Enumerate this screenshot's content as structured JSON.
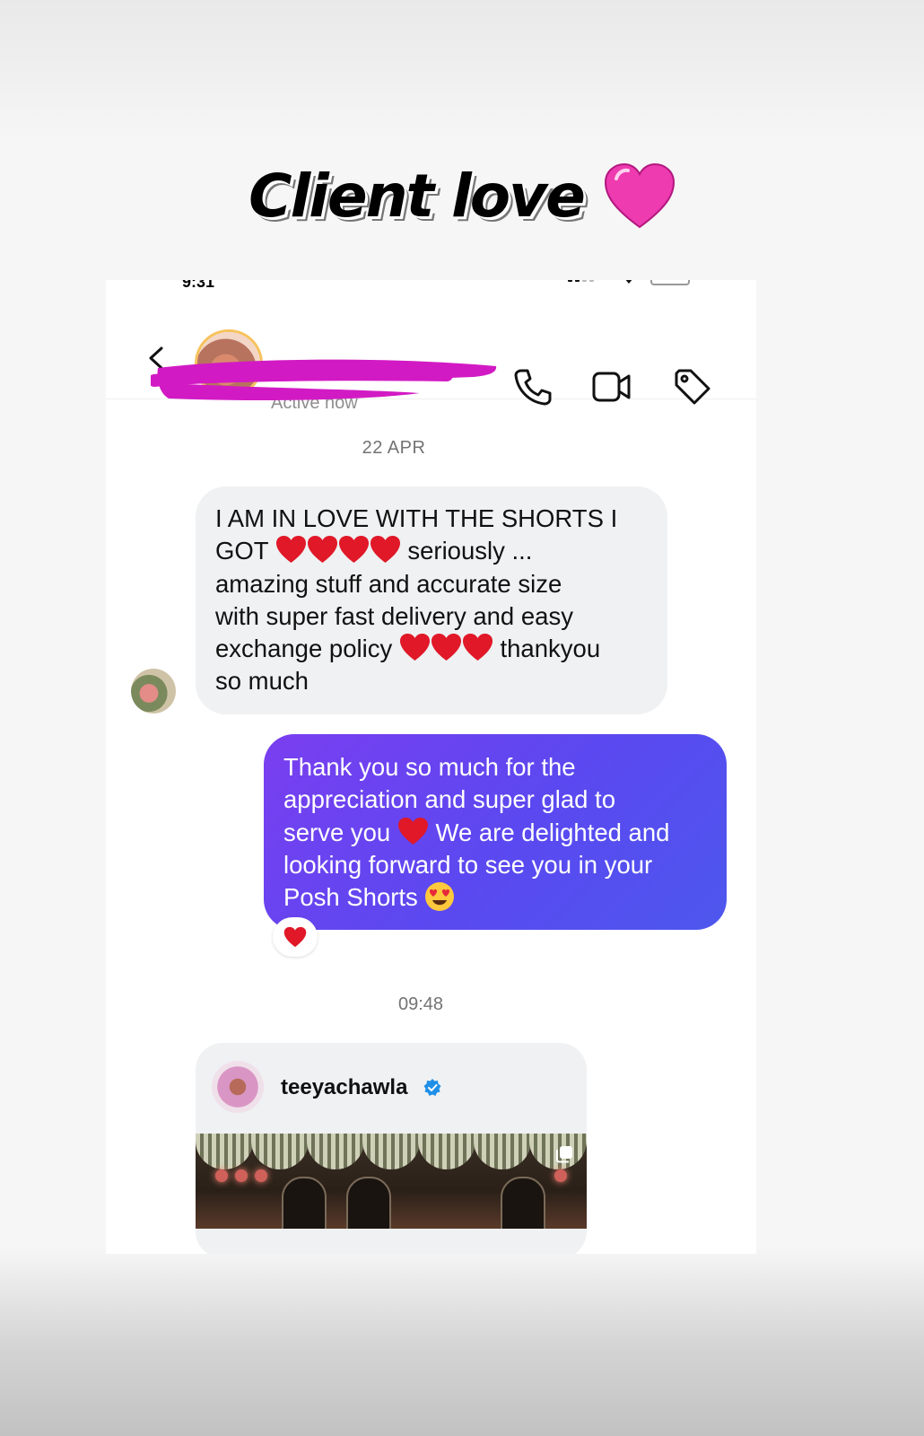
{
  "story": {
    "title": "Client love",
    "heart_color": "#ee3bb0"
  },
  "status_bar": {
    "time": "9:31"
  },
  "header": {
    "active_status": "Active now",
    "icons": [
      "back-icon",
      "phone-icon",
      "video-camera-icon",
      "tag-icon"
    ]
  },
  "conversation": {
    "date_label": "22 APR",
    "incoming": {
      "line1": "I AM IN LOVE WITH THE SHORTS I",
      "line2_a": "GOT",
      "line2_b": "seriously ...",
      "line3": "amazing stuff and accurate size",
      "line4": "with super fast delivery and easy",
      "line5_a": "exchange policy",
      "line5_b": "thankyou",
      "line6": "so much"
    },
    "outgoing": {
      "line1": "Thank you so much for the",
      "line2": "appreciation and super glad to",
      "line3_a": "serve you",
      "line3_b": "We are delighted and",
      "line4": "looking forward to see you in your",
      "line5": "Posh Shorts",
      "bubble_color": "#5a49f0"
    },
    "reaction": "heart",
    "time_label": "09:48",
    "shared_post": {
      "username": "teeyachawla"
    }
  }
}
